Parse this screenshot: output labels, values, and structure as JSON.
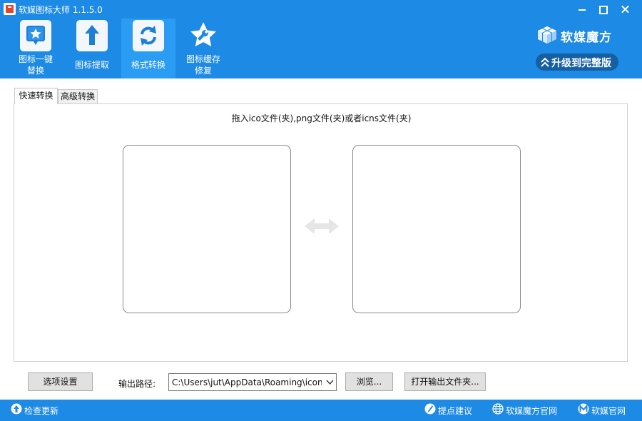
{
  "window": {
    "title": "软媒图标大师 1.1.5.0"
  },
  "toolbar": {
    "items": [
      {
        "line1": "图标一键",
        "line2": "替换",
        "icon": "star-frame-icon"
      },
      {
        "label": "图标提取",
        "icon": "upload-arrow-icon"
      },
      {
        "label": "格式转换",
        "icon": "refresh-icon",
        "active": true
      },
      {
        "line1": "图标缓存",
        "line2": "修复",
        "icon": "star-wrench-icon"
      }
    ]
  },
  "brand": {
    "name": "软媒魔方",
    "upgrade_label": "升级到完整版"
  },
  "tabs": [
    {
      "label": "快速转换",
      "active": true
    },
    {
      "label": "高级转换",
      "active": false
    }
  ],
  "main": {
    "hint": "拖入ico文件(夹),png文件(夹)或者icns文件(夹)"
  },
  "bottom": {
    "settings_label": "选项设置",
    "output_label": "输出路径:",
    "output_path": "C:\\Users\\jut\\AppData\\Roaming\\iconr",
    "browse_label": "浏览...",
    "open_folder_label": "打开输出文件夹..."
  },
  "statusbar": {
    "check_update": "检查更新",
    "feedback": "提点建议",
    "mofang_site": "软媒魔方官网",
    "ruanmei_site": "软媒官网"
  },
  "colors": {
    "primary": "#1d8ae6",
    "active_tab": "#2a9cf3",
    "badge": "#165fa1"
  }
}
